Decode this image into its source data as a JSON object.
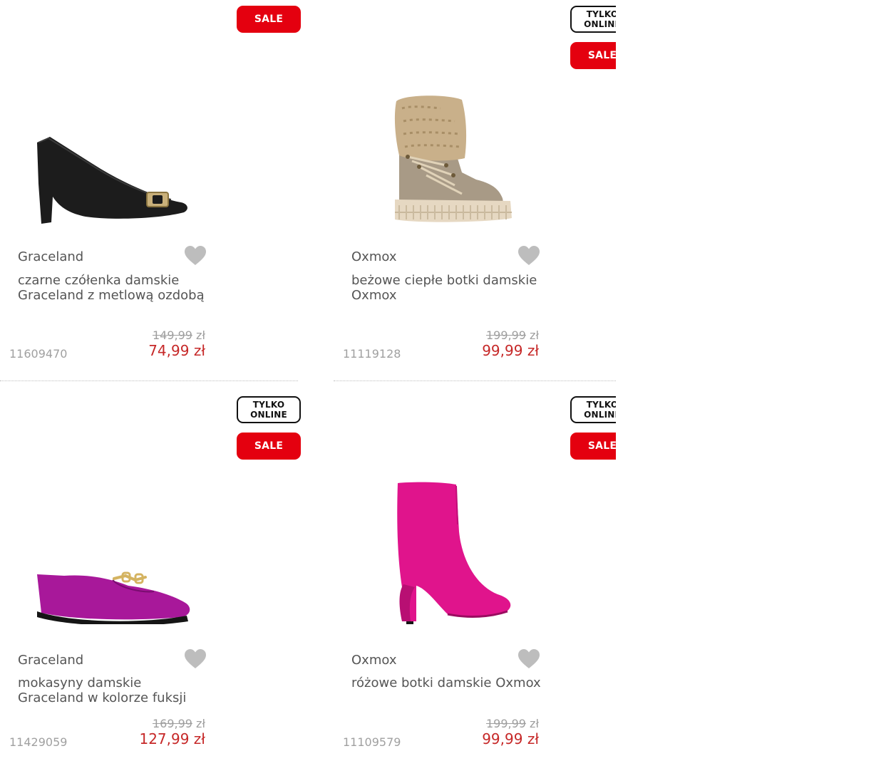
{
  "products": [
    {
      "badges": {
        "sale": "SALE"
      },
      "brand": "Graceland",
      "title": "czarne czółenka damskie Graceland z metlową ozdobą",
      "old_price": "149,99",
      "currency": "zł",
      "new_price": "74,99 zł",
      "sku": "11609470",
      "image_icon": "black-pump-heel",
      "color": "#1a1a1a"
    },
    {
      "badges": {
        "online": "TYLKO\nONLINE",
        "sale": "SALE"
      },
      "brand": "Oxmox",
      "title": "beżowe ciepłe botki damskie Oxmox",
      "old_price": "199,99",
      "currency": "zł",
      "new_price": "99,99 zł",
      "sku": "11119128",
      "image_icon": "beige-fur-boot",
      "color": "#b8a890"
    },
    {
      "badges": {
        "online": "TYLKO\nONLINE",
        "sale": "SALE"
      },
      "brand": "Graceland",
      "title": "mokasyny damskie Graceland w kolorze fuksji",
      "old_price": "169,99",
      "currency": "zł",
      "new_price": "127,99 zł",
      "sku": "11429059",
      "image_icon": "fuchsia-loafer",
      "color": "#a8189a"
    },
    {
      "badges": {
        "online": "TYLKO\nONLINE",
        "sale": "SALE"
      },
      "brand": "Oxmox",
      "title": "różowe botki damskie Oxmox",
      "old_price": "199,99",
      "currency": "zł",
      "new_price": "99,99 zł",
      "sku": "11109579",
      "image_icon": "pink-ankle-boot",
      "color": "#e0148c"
    }
  ],
  "colors": {
    "sale_badge": "#e4000f",
    "price_new": "#c62828",
    "price_old": "#9e9e9e",
    "text": "#555555",
    "wishlist_heart": "#bdbdbd"
  }
}
